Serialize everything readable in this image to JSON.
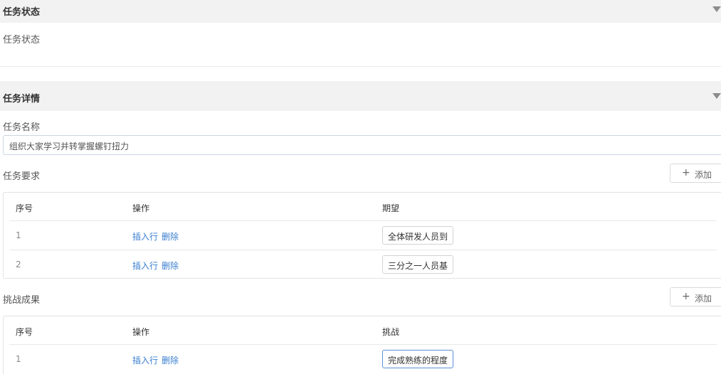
{
  "status_section": {
    "header_title": "任务状态",
    "field_label": "任务状态"
  },
  "detail_section": {
    "header_title": "任务详情",
    "name_label": "任务名称",
    "name_value": "组织大家学习并转掌握螺钉扭力",
    "requirements": {
      "label": "任务要求",
      "add_label": "添加",
      "columns": [
        "序号",
        "操作",
        "期望"
      ],
      "rows": [
        {
          "index": "1",
          "insert": "插入行",
          "delete": "删除",
          "value": "全体研发人员到"
        },
        {
          "index": "2",
          "insert": "插入行",
          "delete": "删除",
          "value": "三分之一人员基"
        }
      ]
    },
    "results": {
      "label": "挑战成果",
      "add_label": "添加",
      "columns": [
        "序号",
        "操作",
        "挑战"
      ],
      "rows": [
        {
          "index": "1",
          "insert": "插入行",
          "delete": "删除",
          "value": "完成熟练的程度"
        }
      ]
    }
  },
  "colors": {
    "link": "#3a7fd0",
    "header_bg": "#f2f2f2",
    "focus_border": "#5b8fd6"
  }
}
